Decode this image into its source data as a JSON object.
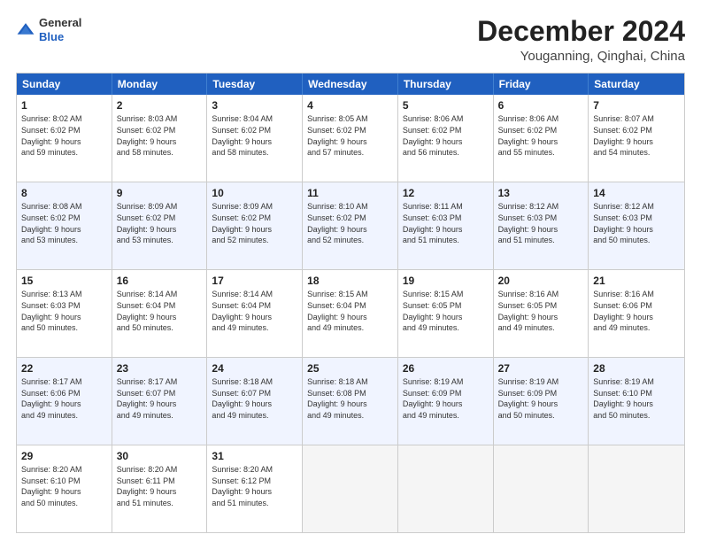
{
  "logo": {
    "general": "General",
    "blue": "Blue"
  },
  "title": "December 2024",
  "subtitle": "Youganning, Qinghai, China",
  "header_days": [
    "Sunday",
    "Monday",
    "Tuesday",
    "Wednesday",
    "Thursday",
    "Friday",
    "Saturday"
  ],
  "weeks": [
    {
      "alt": false,
      "cells": [
        {
          "day": "1",
          "lines": [
            "Sunrise: 8:02 AM",
            "Sunset: 6:02 PM",
            "Daylight: 9 hours",
            "and 59 minutes."
          ]
        },
        {
          "day": "2",
          "lines": [
            "Sunrise: 8:03 AM",
            "Sunset: 6:02 PM",
            "Daylight: 9 hours",
            "and 58 minutes."
          ]
        },
        {
          "day": "3",
          "lines": [
            "Sunrise: 8:04 AM",
            "Sunset: 6:02 PM",
            "Daylight: 9 hours",
            "and 58 minutes."
          ]
        },
        {
          "day": "4",
          "lines": [
            "Sunrise: 8:05 AM",
            "Sunset: 6:02 PM",
            "Daylight: 9 hours",
            "and 57 minutes."
          ]
        },
        {
          "day": "5",
          "lines": [
            "Sunrise: 8:06 AM",
            "Sunset: 6:02 PM",
            "Daylight: 9 hours",
            "and 56 minutes."
          ]
        },
        {
          "day": "6",
          "lines": [
            "Sunrise: 8:06 AM",
            "Sunset: 6:02 PM",
            "Daylight: 9 hours",
            "and 55 minutes."
          ]
        },
        {
          "day": "7",
          "lines": [
            "Sunrise: 8:07 AM",
            "Sunset: 6:02 PM",
            "Daylight: 9 hours",
            "and 54 minutes."
          ]
        }
      ]
    },
    {
      "alt": true,
      "cells": [
        {
          "day": "8",
          "lines": [
            "Sunrise: 8:08 AM",
            "Sunset: 6:02 PM",
            "Daylight: 9 hours",
            "and 53 minutes."
          ]
        },
        {
          "day": "9",
          "lines": [
            "Sunrise: 8:09 AM",
            "Sunset: 6:02 PM",
            "Daylight: 9 hours",
            "and 53 minutes."
          ]
        },
        {
          "day": "10",
          "lines": [
            "Sunrise: 8:09 AM",
            "Sunset: 6:02 PM",
            "Daylight: 9 hours",
            "and 52 minutes."
          ]
        },
        {
          "day": "11",
          "lines": [
            "Sunrise: 8:10 AM",
            "Sunset: 6:02 PM",
            "Daylight: 9 hours",
            "and 52 minutes."
          ]
        },
        {
          "day": "12",
          "lines": [
            "Sunrise: 8:11 AM",
            "Sunset: 6:03 PM",
            "Daylight: 9 hours",
            "and 51 minutes."
          ]
        },
        {
          "day": "13",
          "lines": [
            "Sunrise: 8:12 AM",
            "Sunset: 6:03 PM",
            "Daylight: 9 hours",
            "and 51 minutes."
          ]
        },
        {
          "day": "14",
          "lines": [
            "Sunrise: 8:12 AM",
            "Sunset: 6:03 PM",
            "Daylight: 9 hours",
            "and 50 minutes."
          ]
        }
      ]
    },
    {
      "alt": false,
      "cells": [
        {
          "day": "15",
          "lines": [
            "Sunrise: 8:13 AM",
            "Sunset: 6:03 PM",
            "Daylight: 9 hours",
            "and 50 minutes."
          ]
        },
        {
          "day": "16",
          "lines": [
            "Sunrise: 8:14 AM",
            "Sunset: 6:04 PM",
            "Daylight: 9 hours",
            "and 50 minutes."
          ]
        },
        {
          "day": "17",
          "lines": [
            "Sunrise: 8:14 AM",
            "Sunset: 6:04 PM",
            "Daylight: 9 hours",
            "and 49 minutes."
          ]
        },
        {
          "day": "18",
          "lines": [
            "Sunrise: 8:15 AM",
            "Sunset: 6:04 PM",
            "Daylight: 9 hours",
            "and 49 minutes."
          ]
        },
        {
          "day": "19",
          "lines": [
            "Sunrise: 8:15 AM",
            "Sunset: 6:05 PM",
            "Daylight: 9 hours",
            "and 49 minutes."
          ]
        },
        {
          "day": "20",
          "lines": [
            "Sunrise: 8:16 AM",
            "Sunset: 6:05 PM",
            "Daylight: 9 hours",
            "and 49 minutes."
          ]
        },
        {
          "day": "21",
          "lines": [
            "Sunrise: 8:16 AM",
            "Sunset: 6:06 PM",
            "Daylight: 9 hours",
            "and 49 minutes."
          ]
        }
      ]
    },
    {
      "alt": true,
      "cells": [
        {
          "day": "22",
          "lines": [
            "Sunrise: 8:17 AM",
            "Sunset: 6:06 PM",
            "Daylight: 9 hours",
            "and 49 minutes."
          ]
        },
        {
          "day": "23",
          "lines": [
            "Sunrise: 8:17 AM",
            "Sunset: 6:07 PM",
            "Daylight: 9 hours",
            "and 49 minutes."
          ]
        },
        {
          "day": "24",
          "lines": [
            "Sunrise: 8:18 AM",
            "Sunset: 6:07 PM",
            "Daylight: 9 hours",
            "and 49 minutes."
          ]
        },
        {
          "day": "25",
          "lines": [
            "Sunrise: 8:18 AM",
            "Sunset: 6:08 PM",
            "Daylight: 9 hours",
            "and 49 minutes."
          ]
        },
        {
          "day": "26",
          "lines": [
            "Sunrise: 8:19 AM",
            "Sunset: 6:09 PM",
            "Daylight: 9 hours",
            "and 49 minutes."
          ]
        },
        {
          "day": "27",
          "lines": [
            "Sunrise: 8:19 AM",
            "Sunset: 6:09 PM",
            "Daylight: 9 hours",
            "and 50 minutes."
          ]
        },
        {
          "day": "28",
          "lines": [
            "Sunrise: 8:19 AM",
            "Sunset: 6:10 PM",
            "Daylight: 9 hours",
            "and 50 minutes."
          ]
        }
      ]
    },
    {
      "alt": false,
      "cells": [
        {
          "day": "29",
          "lines": [
            "Sunrise: 8:20 AM",
            "Sunset: 6:10 PM",
            "Daylight: 9 hours",
            "and 50 minutes."
          ]
        },
        {
          "day": "30",
          "lines": [
            "Sunrise: 8:20 AM",
            "Sunset: 6:11 PM",
            "Daylight: 9 hours",
            "and 51 minutes."
          ]
        },
        {
          "day": "31",
          "lines": [
            "Sunrise: 8:20 AM",
            "Sunset: 6:12 PM",
            "Daylight: 9 hours",
            "and 51 minutes."
          ]
        },
        {
          "day": "",
          "lines": []
        },
        {
          "day": "",
          "lines": []
        },
        {
          "day": "",
          "lines": []
        },
        {
          "day": "",
          "lines": []
        }
      ]
    }
  ]
}
